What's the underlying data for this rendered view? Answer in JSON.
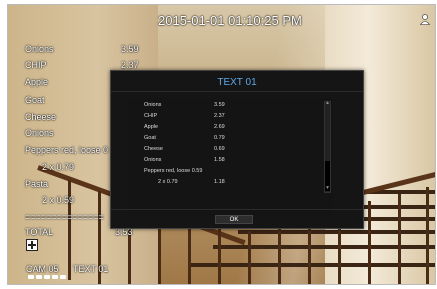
{
  "overlay": {
    "clock": "2015-01-01 01:10:25 PM",
    "items": [
      {
        "label": "Onions",
        "value": "3.59"
      },
      {
        "label": "CHIP",
        "value": "2.37"
      },
      {
        "label": "Apple",
        "value": ""
      },
      {
        "label": "Goat",
        "value": ""
      },
      {
        "label": "Cheese",
        "value": ""
      },
      {
        "label": "Onions",
        "value": ""
      },
      {
        "label": "Peppers red, loose 0",
        "value": ""
      },
      {
        "label": "2 x 0.79",
        "value": ""
      },
      {
        "label": "Pasta",
        "value": ""
      },
      {
        "label": "2 x 0.59",
        "value": ""
      }
    ],
    "separator": "===============",
    "total_label": "TOTAL",
    "total_value": "3.53",
    "camera": "CAM 05",
    "text_name": "TEXT 01"
  },
  "dialog": {
    "title": "TEXT 01",
    "rows": [
      {
        "name": "Onions",
        "value": "3.59"
      },
      {
        "name": "CHIP",
        "value": "2.37"
      },
      {
        "name": "Apple",
        "value": "2.69"
      },
      {
        "name": "Goat",
        "value": "0.79"
      },
      {
        "name": "Cheese",
        "value": "0.69"
      },
      {
        "name": "Onions",
        "value": "1.58"
      },
      {
        "name": "Peppers red, loose 0.59",
        "value": ""
      },
      {
        "name": "2 x 0.79",
        "value": "1.18"
      }
    ],
    "ok_label": "OK"
  },
  "icons": {
    "user": "user-icon",
    "add": "plus-icon"
  },
  "colors": {
    "dialog_title": "#5fa8e8",
    "dialog_bg": "#151515"
  }
}
